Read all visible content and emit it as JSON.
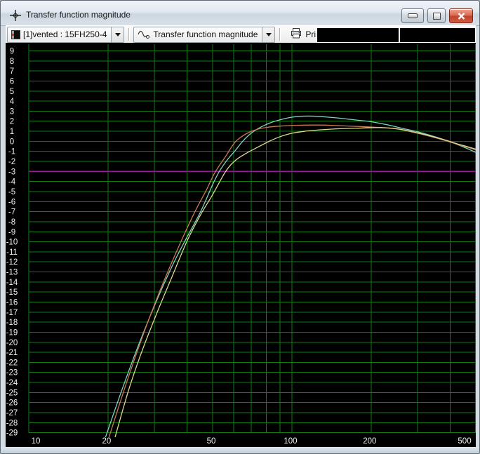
{
  "window": {
    "title": "Transfer function magnitude",
    "controls": {
      "minimize": "minimize",
      "maximize": "maximize",
      "close": "close"
    }
  },
  "toolbar": {
    "project_selector": {
      "value": "[1]vented : 15FH250-4",
      "icon": "project-box-icon"
    },
    "graph_selector": {
      "value": "Transfer function magnitude",
      "icon": "sine-wave-icon"
    },
    "print_button": {
      "label": "Print",
      "icon": "printer-icon"
    },
    "readouts": [
      "",
      ""
    ]
  },
  "chart_data": {
    "type": "line",
    "title": "Transfer function magnitude",
    "x_scale": "log",
    "x_range": [
      10,
      500
    ],
    "x_major_ticks": [
      10,
      20,
      50,
      100,
      200,
      500
    ],
    "x_gridlines": [
      10,
      20,
      30,
      40,
      50,
      60,
      70,
      80,
      90,
      100,
      200,
      300,
      400,
      500
    ],
    "y_ticks": {
      "from": 9,
      "to": -29,
      "step": -1
    },
    "grid_on": true,
    "legend": "none",
    "background": "#000000",
    "grid_color": "#107c12",
    "label_color": "#f2f2f2",
    "reference_lines": [
      {
        "value": 0,
        "color": "#c01010",
        "name": "zero-db-line"
      },
      {
        "value": -3,
        "color": "#9a1b9a",
        "name": "minus-3db-line"
      }
    ],
    "series": [
      {
        "name": "response-cyan",
        "color": "#80d4c0",
        "points": [
          [
            19.6,
            -29.4
          ],
          [
            22,
            -25.6
          ],
          [
            25,
            -21.6
          ],
          [
            28,
            -18.3
          ],
          [
            32,
            -14.7
          ],
          [
            36,
            -11.8
          ],
          [
            40,
            -9.5
          ],
          [
            45,
            -7.0
          ],
          [
            50,
            -4.3
          ],
          [
            53,
            -3.0
          ],
          [
            57,
            -1.8
          ],
          [
            61,
            -0.9
          ],
          [
            65,
            0.0
          ],
          [
            70,
            0.8
          ],
          [
            76,
            1.4
          ],
          [
            84,
            1.9
          ],
          [
            92,
            2.2
          ],
          [
            100,
            2.4
          ],
          [
            110,
            2.5
          ],
          [
            122,
            2.5
          ],
          [
            135,
            2.42
          ],
          [
            155,
            2.28
          ],
          [
            175,
            2.12
          ],
          [
            200,
            1.95
          ],
          [
            230,
            1.65
          ],
          [
            260,
            1.32
          ],
          [
            300,
            0.95
          ],
          [
            340,
            0.55
          ],
          [
            380,
            0.15
          ],
          [
            420,
            -0.25
          ],
          [
            460,
            -0.68
          ],
          [
            500,
            -1.1
          ]
        ]
      },
      {
        "name": "response-orange",
        "color": "#c97a55",
        "points": [
          [
            20.2,
            -29.4
          ],
          [
            23,
            -24.8
          ],
          [
            26,
            -20.7
          ],
          [
            29,
            -17.3
          ],
          [
            33,
            -13.6
          ],
          [
            38,
            -9.9
          ],
          [
            43,
            -6.9
          ],
          [
            47,
            -5.0
          ],
          [
            51,
            -3.1
          ],
          [
            56,
            -1.5
          ],
          [
            61,
            -0.05
          ],
          [
            67,
            0.75
          ],
          [
            74,
            1.2
          ],
          [
            82,
            1.42
          ],
          [
            92,
            1.53
          ],
          [
            105,
            1.6
          ],
          [
            125,
            1.62
          ],
          [
            145,
            1.58
          ],
          [
            170,
            1.5
          ],
          [
            200,
            1.42
          ],
          [
            235,
            1.32
          ],
          [
            265,
            1.12
          ],
          [
            300,
            0.8
          ],
          [
            340,
            0.45
          ],
          [
            380,
            0.1
          ],
          [
            425,
            -0.3
          ],
          [
            460,
            -0.55
          ],
          [
            500,
            -0.85
          ]
        ]
      },
      {
        "name": "response-yellow",
        "color": "#dcd98e",
        "points": [
          [
            21.3,
            -29.4
          ],
          [
            24,
            -24.7
          ],
          [
            27,
            -20.8
          ],
          [
            31,
            -16.8
          ],
          [
            35,
            -13.5
          ],
          [
            40,
            -9.9
          ],
          [
            45,
            -7.3
          ],
          [
            50,
            -5.3
          ],
          [
            56,
            -3.0
          ],
          [
            61,
            -1.9
          ],
          [
            67,
            -1.2
          ],
          [
            74,
            -0.6
          ],
          [
            82,
            0.0
          ],
          [
            90,
            0.45
          ],
          [
            100,
            0.8
          ],
          [
            112,
            1.0
          ],
          [
            130,
            1.15
          ],
          [
            150,
            1.25
          ],
          [
            175,
            1.3
          ],
          [
            200,
            1.35
          ],
          [
            225,
            1.35
          ],
          [
            255,
            1.22
          ],
          [
            300,
            0.85
          ],
          [
            340,
            0.5
          ],
          [
            380,
            0.15
          ],
          [
            425,
            -0.25
          ],
          [
            460,
            -0.5
          ],
          [
            500,
            -0.78
          ]
        ]
      }
    ]
  }
}
